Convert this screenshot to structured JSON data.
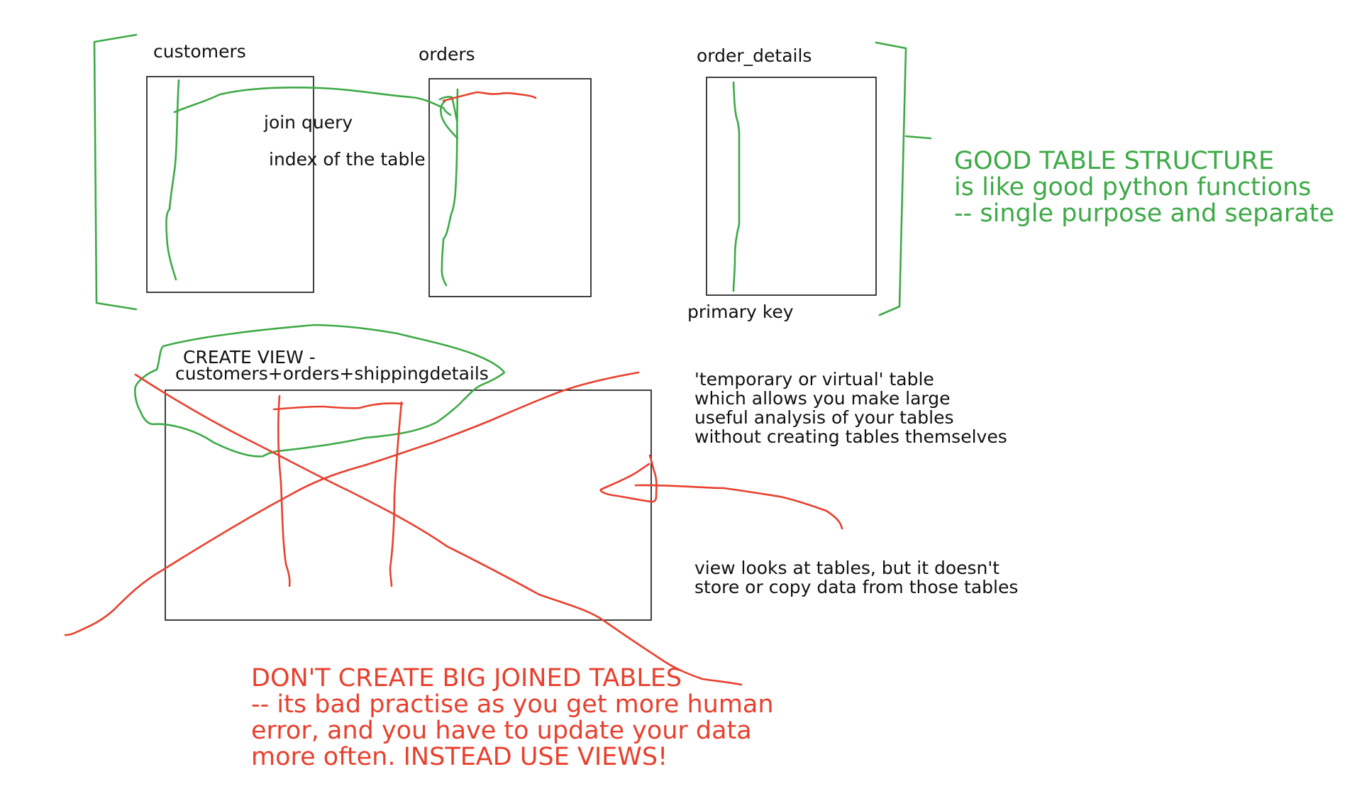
{
  "colors": {
    "ink": "#111111",
    "green": "#3daa47",
    "red": "#e8402e",
    "background": "#ffffff"
  },
  "tables": {
    "customers": "customers",
    "orders": "orders",
    "order_details": "order_details"
  },
  "annotations": {
    "join_query": "join query",
    "index_of_table": "index of the table",
    "primary_key": "primary key",
    "create_view_line1": "CREATE VIEW -",
    "create_view_line2": "customers+orders+shippingdetails"
  },
  "view_notes": {
    "virtual_table": [
      "'temporary or virtual' table",
      "which allows you make large",
      "useful analysis of your tables",
      "without creating tables themselves"
    ],
    "no_copy": [
      "view looks at tables, but it doesn't",
      "store or copy data from those tables"
    ]
  },
  "good_structure": [
    "GOOD TABLE STRUCTURE",
    "is like good python functions",
    "-- single purpose and separate"
  ],
  "dont_create": [
    "DON'T CREATE BIG JOINED TABLES",
    "-- its bad practise as you get more human",
    "error, and you have to update your data",
    "more often. INSTEAD USE VIEWS!"
  ]
}
